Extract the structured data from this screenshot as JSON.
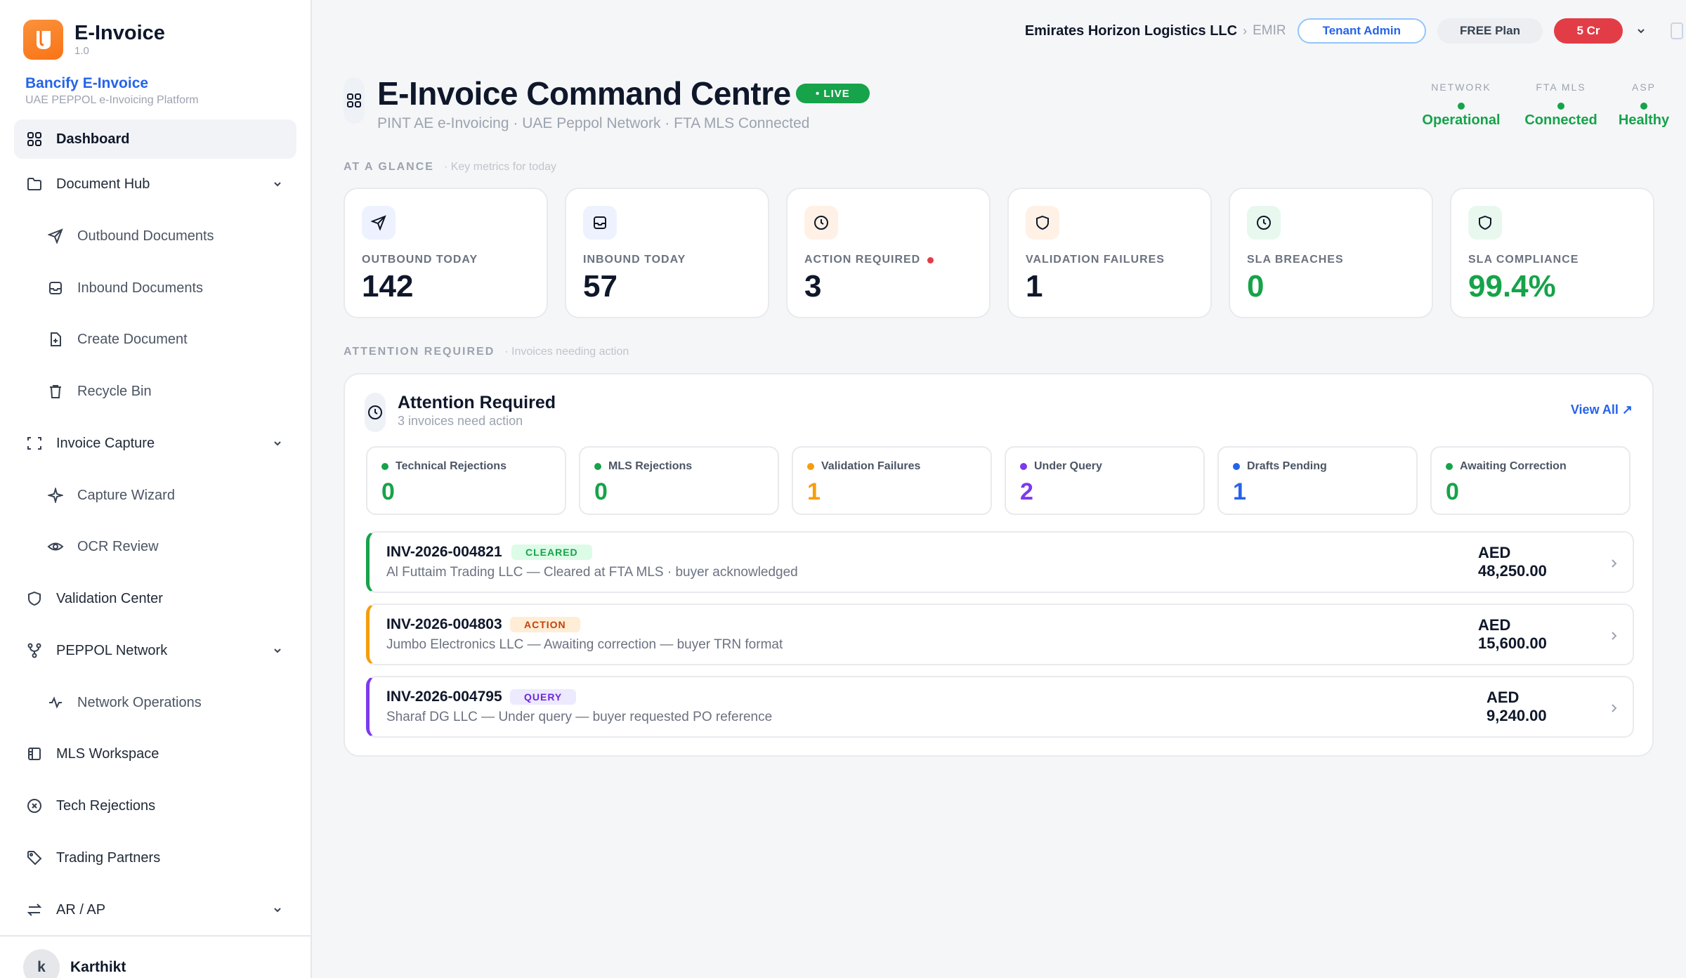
{
  "sidebar": {
    "app_name": "E-Invoice",
    "version": "1.0",
    "org_name": "Bancify E-Invoice",
    "org_sub": "UAE PEPPOL e-Invoicing Platform",
    "items": [
      {
        "label": "Dashboard",
        "icon": "grid-icon",
        "active": true
      },
      {
        "label": "Document Hub",
        "icon": "folder-icon"
      },
      {
        "label": "Outbound Documents",
        "icon": "send-icon"
      },
      {
        "label": "Inbound Documents",
        "icon": "inbox-icon"
      },
      {
        "label": "Create Document",
        "icon": "file-plus-icon"
      },
      {
        "label": "Recycle Bin",
        "icon": "trash-icon"
      },
      {
        "label": "Invoice Capture",
        "icon": "scan-icon"
      },
      {
        "label": "Capture Wizard",
        "icon": "sparkle-icon"
      },
      {
        "label": "OCR Review",
        "icon": "eye-icon"
      },
      {
        "label": "Validation Center",
        "icon": "shield-icon"
      },
      {
        "label": "PEPPOL Network",
        "icon": "network-icon"
      },
      {
        "label": "Network Operations",
        "icon": "activity-icon"
      },
      {
        "label": "MLS Workspace",
        "icon": "panel-icon"
      },
      {
        "label": "Tech Rejections",
        "icon": "x-circle-icon"
      },
      {
        "label": "Trading Partners",
        "icon": "tag-icon"
      },
      {
        "label": "AR / AP",
        "icon": "arrows-icon"
      }
    ],
    "user": {
      "initial": "k",
      "name": "Karthikt"
    }
  },
  "topbar": {
    "tenant": "Emirates Horizon Logistics LLC",
    "separator": "›",
    "tenant_code": "EMIR",
    "role": "Tenant Admin",
    "plan": "FREE Plan",
    "credits": "5 Cr"
  },
  "header": {
    "title": "E-Invoice Command Centre",
    "live_badge": "• LIVE",
    "subtitle": "PINT AE e-Invoicing · UAE Peppol Network · FTA MLS Connected",
    "status": [
      {
        "label": "NETWORK",
        "value": "Operational"
      },
      {
        "label": "FTA MLS",
        "value": "Connected"
      },
      {
        "label": "ASP",
        "value": "Healthy"
      }
    ]
  },
  "glance": {
    "label": "AT A GLANCE",
    "hint": "· Key metrics for today",
    "metrics": [
      {
        "label": "OUTBOUND TODAY",
        "value": "142",
        "icon": "send-icon",
        "icon_bg": "#eef2ff",
        "value_color": "#0f172a"
      },
      {
        "label": "INBOUND TODAY",
        "value": "57",
        "icon": "inbox-icon",
        "icon_bg": "#eef2ff",
        "value_color": "#0f172a"
      },
      {
        "label": "ACTION REQUIRED",
        "value": "3",
        "icon": "clock-icon",
        "icon_bg": "#fff1e6",
        "value_color": "#0f172a"
      },
      {
        "label": "VALIDATION FAILURES",
        "value": "1",
        "icon": "shield-icon",
        "icon_bg": "#fff1e6",
        "value_color": "#0f172a"
      },
      {
        "label": "SLA BREACHES",
        "value": "0",
        "icon": "clock-icon",
        "icon_bg": "#e9f8ef",
        "value_color": "#16a34a"
      },
      {
        "label": "SLA COMPLIANCE",
        "value": "99.4%",
        "icon": "shield-icon",
        "icon_bg": "#e9f8ef",
        "value_color": "#16a34a"
      }
    ]
  },
  "attention": {
    "label": "ATTENTION REQUIRED",
    "hint": "· Invoices needing action",
    "title": "Attention Required",
    "subtitle": "3 invoices need action",
    "view_all": "View All ↗",
    "counters": [
      {
        "label": "Technical Rejections",
        "value": "0",
        "dot": "#16a34a",
        "color": "#16a34a"
      },
      {
        "label": "MLS Rejections",
        "value": "0",
        "dot": "#16a34a",
        "color": "#16a34a"
      },
      {
        "label": "Validation Failures",
        "value": "1",
        "dot": "#f59e0b",
        "color": "#f59e0b"
      },
      {
        "label": "Under Query",
        "value": "2",
        "dot": "#7c3aed",
        "color": "#7c3aed"
      },
      {
        "label": "Drafts Pending",
        "value": "1",
        "dot": "#2563eb",
        "color": "#2563eb"
      },
      {
        "label": "Awaiting Correction",
        "value": "0",
        "dot": "#16a34a",
        "color": "#16a34a"
      }
    ],
    "invoices": [
      {
        "id": "INV-2026-004821",
        "status": "CLEARED",
        "desc": "Al Futtaim Trading LLC — Cleared at FTA MLS · buyer acknowledged",
        "currency": "AED",
        "amount": "48,250.00",
        "accent": "#16a34a",
        "badge_bg": "#dcfce7",
        "badge_fg": "#16a34a"
      },
      {
        "id": "INV-2026-004803",
        "status": "ACTION",
        "desc": "Jumbo Electronics LLC — Awaiting correction — buyer TRN format",
        "currency": "AED",
        "amount": "15,600.00",
        "accent": "#f59e0b",
        "badge_bg": "#ffedd5",
        "badge_fg": "#c2410c"
      },
      {
        "id": "INV-2026-004795",
        "status": "QUERY",
        "desc": "Sharaf DG LLC — Under query — buyer requested PO reference",
        "currency": "AED",
        "amount": "9,240.00",
        "accent": "#7c3aed",
        "badge_bg": "#ede9fe",
        "badge_fg": "#6d28d9"
      }
    ]
  }
}
